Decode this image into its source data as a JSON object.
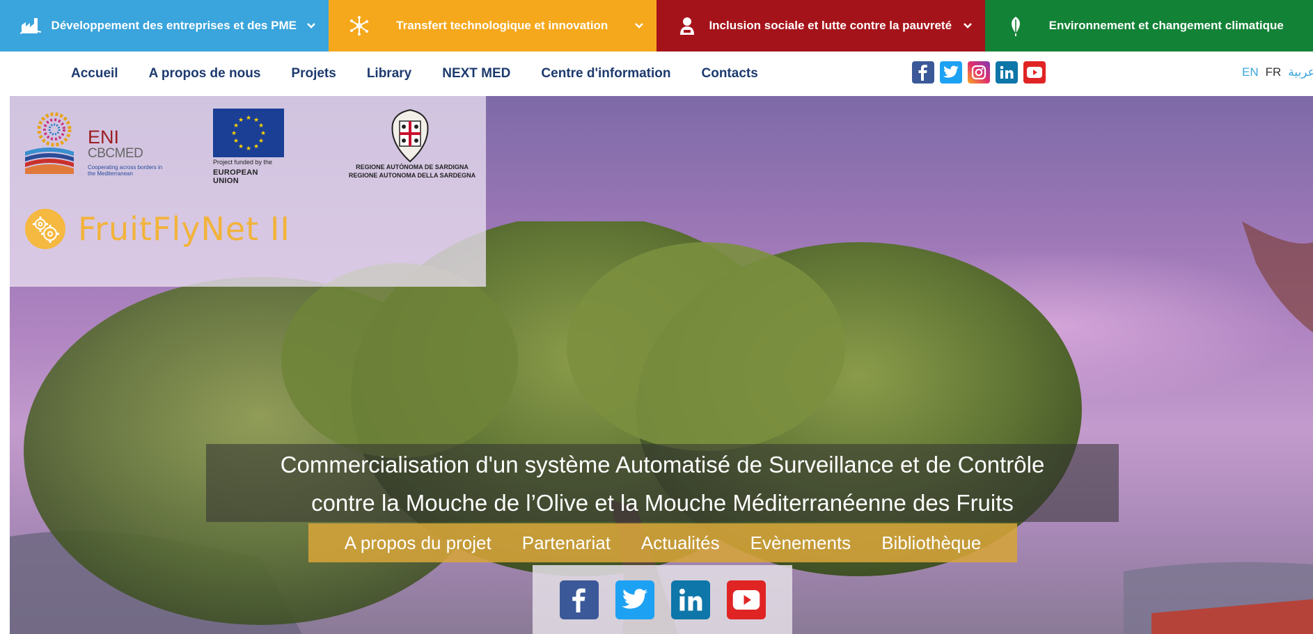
{
  "themes": [
    {
      "label": "Développement des entreprises et des PME",
      "icon": "factory-icon",
      "color": "#3aa4dc"
    },
    {
      "label": "Transfert technologique et innovation",
      "icon": "network-icon",
      "color": "#f5a81c"
    },
    {
      "label": "Inclusion sociale et lutte contre la pauvreté",
      "icon": "person-icon",
      "color": "#a5131a"
    },
    {
      "label": "Environnement et changement climatique",
      "icon": "leaf-icon",
      "color": "#128236"
    }
  ],
  "nav": {
    "items": [
      "Accueil",
      "A propos de nous",
      "Projets",
      "Library",
      "NEXT MED",
      "Centre d'information",
      "Contacts"
    ],
    "social": [
      "facebook",
      "twitter",
      "instagram",
      "linkedin",
      "youtube"
    ],
    "languages": {
      "en": "EN",
      "fr": "FR",
      "ar": "عربية"
    }
  },
  "logos": {
    "eni": "ENI",
    "cbcmed": "CBCMED",
    "eni_tagline": "Cooperating across borders in the Mediterranean",
    "eu_caption_1": "Project funded by the",
    "eu_caption_2": "EUROPEAN UNION",
    "sardegna_caption_1": "REGIONE AUTÒNOMA DE SARDIGNA",
    "sardegna_caption_2": "REGIONE AUTONOMA DELLA SARDEGNA"
  },
  "project": {
    "title": "FruitFlyNet II",
    "headline_line1": "Commercialisation d'un système Automatisé de Surveillance et de Contrôle",
    "headline_line2": "contre la Mouche de l’Olive et la Mouche Méditerranéenne des Fruits",
    "menu": [
      "A propos du projet",
      "Partenariat",
      "Actualités",
      "Evènements",
      "Bibliothèque"
    ],
    "social": [
      "facebook",
      "twitter",
      "linkedin",
      "youtube"
    ]
  },
  "colors": {
    "nav_text": "#1d3a6e",
    "facebook": "#3b5998",
    "twitter": "#1da1f2",
    "linkedin": "#0e76a8",
    "youtube": "#e02424",
    "instagram": "#c13584",
    "project_accent": "#d6a43a"
  }
}
